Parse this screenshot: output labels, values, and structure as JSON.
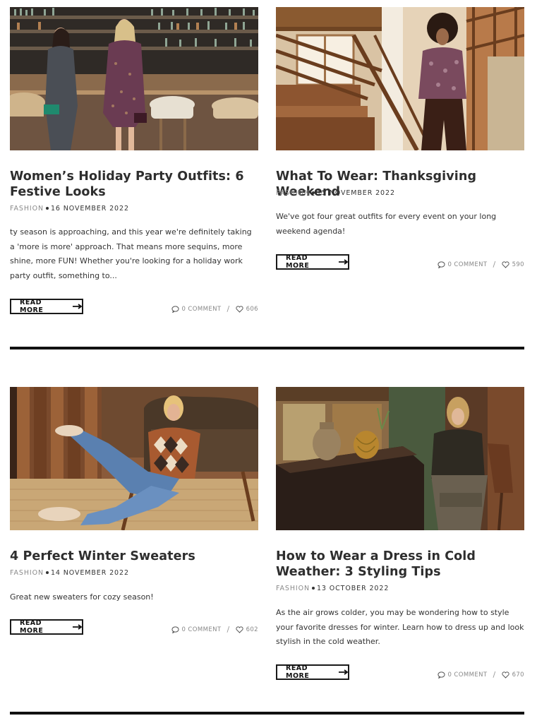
{
  "posts": [
    {
      "title": "Women’s Holiday Party Outfits: 6 Festive Looks",
      "category": "FASHION",
      "date": "16 NOVEMBER 2022",
      "excerpt": "ty season is approaching, and this year we're definitely taking a 'more is more' approach. That means more sequins, more shine, more FUN! Whether you're looking for a holiday work party outfit, something to...",
      "read_more": "READ MORE",
      "comments": "0 COMMENT",
      "likes": "606"
    },
    {
      "title": "What To Wear: Thanksgiving Weekend",
      "category": "FASHION",
      "date": "15 NOVEMBER 2022",
      "excerpt": "We've got four great outfits for every event on your long weekend agenda!",
      "read_more": "READ MORE",
      "comments": "0 COMMENT",
      "likes": "590"
    },
    {
      "title": "4 Perfect Winter Sweaters",
      "category": "FASHION",
      "date": "14 NOVEMBER 2022",
      "excerpt": "Great new sweaters for cozy season!",
      "read_more": "READ MORE",
      "comments": "0 COMMENT",
      "likes": "602"
    },
    {
      "title": "How to Wear a Dress in Cold Weather: 3 Styling Tips",
      "category": "FASHION",
      "date": "13 OCTOBER 2022",
      "excerpt": "As the air grows colder, you may be wondering how to style your favorite dresses for winter. Learn how to dress up and look stylish in the cold weather.",
      "read_more": "READ MORE",
      "comments": "0 COMMENT",
      "likes": "670"
    }
  ],
  "icons": {
    "comment": "comment-icon",
    "like": "heart-icon",
    "arrow": "arrow-right-icon"
  }
}
